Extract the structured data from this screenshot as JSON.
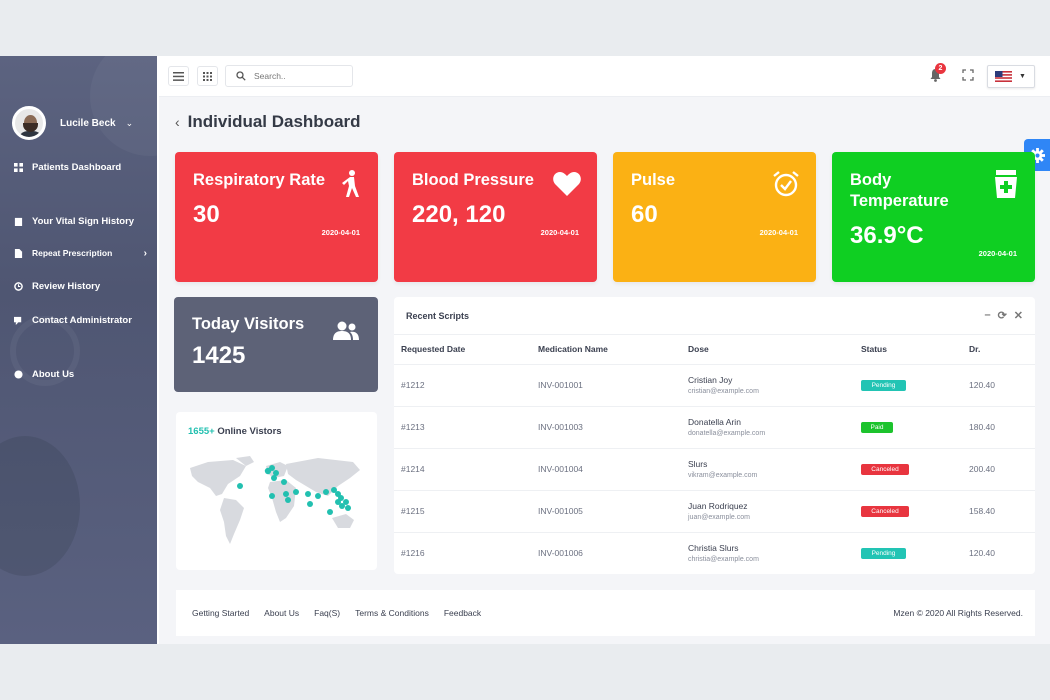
{
  "sidebar": {
    "user_name": "Lucile Beck",
    "items": [
      {
        "label": "Patients Dashboard",
        "icon": "grid-icon"
      },
      {
        "label": "Your Vital Sign History",
        "icon": "clipboard-icon"
      },
      {
        "label": "Repeat Prescription",
        "icon": "file-icon"
      },
      {
        "label": "Review History",
        "icon": "history-icon"
      },
      {
        "label": "Contact Administrator",
        "icon": "chat-icon"
      },
      {
        "label": "About Us",
        "icon": "info-icon"
      }
    ]
  },
  "topbar": {
    "search_placeholder": "Search..",
    "notifications": "2",
    "language_flag": "us-flag-icon"
  },
  "page": {
    "title": "Individual Dashboard"
  },
  "cards": [
    {
      "title": "Respiratory Rate",
      "value": "30",
      "date": "2020-04-01",
      "color": "#f23b45",
      "icon": "walking-person-icon"
    },
    {
      "title": "Blood Pressure",
      "value": "220, 120",
      "date": "2020-04-01",
      "color": "#f23b45",
      "icon": "heart-icon"
    },
    {
      "title": "Pulse",
      "value": "60",
      "date": "2020-04-01",
      "color": "#fbb114",
      "icon": "alarm-clock-icon"
    },
    {
      "title": "Body Temperature",
      "value": "36.9°C",
      "date": "2020-04-01",
      "color": "#0fcf22",
      "icon": "medicine-icon"
    }
  ],
  "visitors": {
    "title": "Today Visitors",
    "value": "1425"
  },
  "online": {
    "count": "1655+",
    "label": "Online Vistors"
  },
  "scripts": {
    "title": "Recent Scripts",
    "columns": [
      "Requested Date",
      "Medication Name",
      "Dose",
      "Status",
      "Dr."
    ],
    "rows": [
      {
        "date": "#1212",
        "med": "INV-001001",
        "name": "Cristian Joy",
        "email": "cristian@example.com",
        "status": "Pending",
        "status_color": "#22c4b4",
        "dr": "120.40"
      },
      {
        "date": "#1213",
        "med": "INV-001003",
        "name": "Donatella Arin",
        "email": "donatella@example.com",
        "status": "Paid",
        "status_color": "#1cc32d",
        "dr": "180.40"
      },
      {
        "date": "#1214",
        "med": "INV-001004",
        "name": "Slurs",
        "email": "vikram@example.com",
        "status": "Canceled",
        "status_color": "#e8353f",
        "dr": "200.40"
      },
      {
        "date": "#1215",
        "med": "INV-001005",
        "name": "Juan Rodriquez",
        "email": "juan@example.com",
        "status": "Canceled",
        "status_color": "#e8353f",
        "dr": "158.40"
      },
      {
        "date": "#1216",
        "med": "INV-001006",
        "name": "Christia Slurs",
        "email": "christia@example.com",
        "status": "Pending",
        "status_color": "#22c4b4",
        "dr": "120.40"
      }
    ]
  },
  "footer": {
    "links": [
      "Getting Started",
      "About Us",
      "Faq(S)",
      "Terms & Conditions",
      "Feedback"
    ],
    "copyright": "Mzen © 2020 All Rights Reserved."
  }
}
